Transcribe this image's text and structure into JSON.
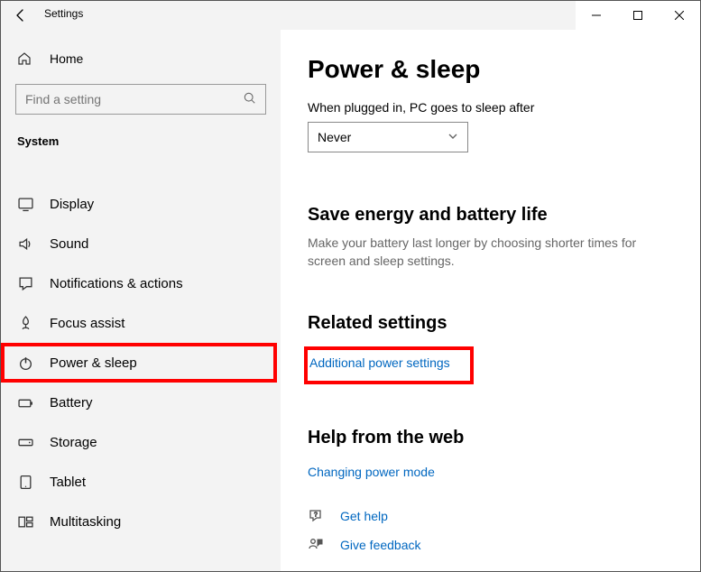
{
  "window": {
    "title": "Settings"
  },
  "sidebar": {
    "home": "Home",
    "search_placeholder": "Find a setting",
    "heading": "System",
    "items": [
      {
        "label": "Display"
      },
      {
        "label": "Sound"
      },
      {
        "label": "Notifications & actions"
      },
      {
        "label": "Focus assist"
      },
      {
        "label": "Power & sleep"
      },
      {
        "label": "Battery"
      },
      {
        "label": "Storage"
      },
      {
        "label": "Tablet"
      },
      {
        "label": "Multitasking"
      }
    ]
  },
  "main": {
    "title": "Power & sleep",
    "plugged_label": "When plugged in, PC goes to sleep after",
    "plugged_value": "Never",
    "save_heading": "Save energy and battery life",
    "save_text": "Make your battery last longer by choosing shorter times for screen and sleep settings.",
    "related_heading": "Related settings",
    "related_link": "Additional power settings",
    "help_heading": "Help from the web",
    "help_link": "Changing power mode",
    "get_help": "Get help",
    "give_feedback": "Give feedback"
  }
}
